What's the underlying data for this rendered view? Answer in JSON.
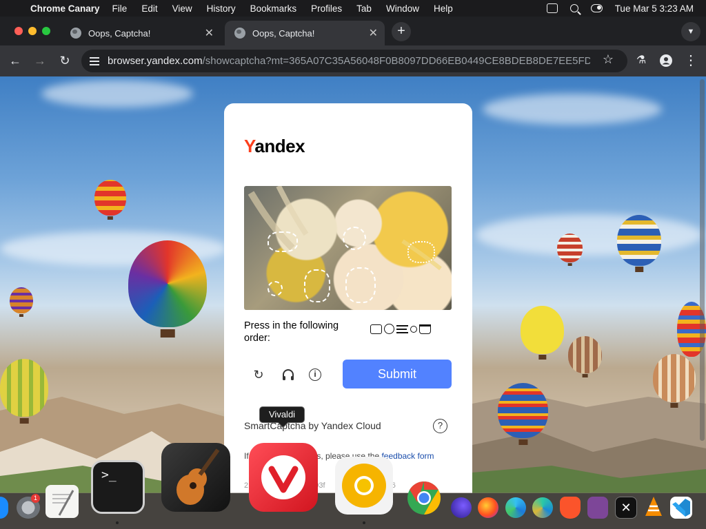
{
  "menubar": {
    "apple_icon": "apple-logo-icon",
    "app_name": "Chrome Canary",
    "items": [
      "File",
      "Edit",
      "View",
      "History",
      "Bookmarks",
      "Profiles",
      "Tab",
      "Window",
      "Help"
    ],
    "datetime": "Tue Mar 5  3:23 AM"
  },
  "tabs": [
    {
      "title": "Oops, Captcha!",
      "active": false
    },
    {
      "title": "Oops, Captcha!",
      "active": true
    }
  ],
  "toolbar": {
    "url_host": "browser.yandex.com",
    "url_path": "/showcaptcha?mt=365A07C35A56048F0B8097DD66EB0449CE8BDEB8DE7EE5FD..."
  },
  "captcha": {
    "logo_y": "Y",
    "logo_rest": "andex",
    "prompt": "Press in the following order:",
    "order_icons": [
      "camera-icon",
      "target-icon",
      "lines-icon",
      "pin-icon",
      "basket-icon"
    ],
    "submit_label": "Submit",
    "footer": "SmartCaptcha by Yandex Cloud",
    "help_label": "?",
    "problems_prefix": "If you have problems, please use the",
    "feedback_link": "feedback form",
    "request_id_prefix": "2",
    "request_id_mid": "d93f",
    "request_id_suffix": "096"
  },
  "tooltip": {
    "text": "Vivaldi"
  },
  "dock": {
    "apps": [
      "App Store",
      "System Settings",
      "TextEdit",
      "Terminal",
      "GarageBand",
      "Vivaldi",
      "Chrome Canary",
      "Google Chrome",
      "Firefox",
      "Firefox Nightly",
      "Microsoft Edge",
      "Microsoft Edge Canary",
      "Brave",
      "Tor",
      "CapCut",
      "VLC",
      "Visual Studio Code"
    ],
    "settings_badge": "1"
  },
  "colors": {
    "accent_submit": "#5282ff",
    "yandex_red": "#fc3f1d",
    "link": "#1a4dab"
  }
}
